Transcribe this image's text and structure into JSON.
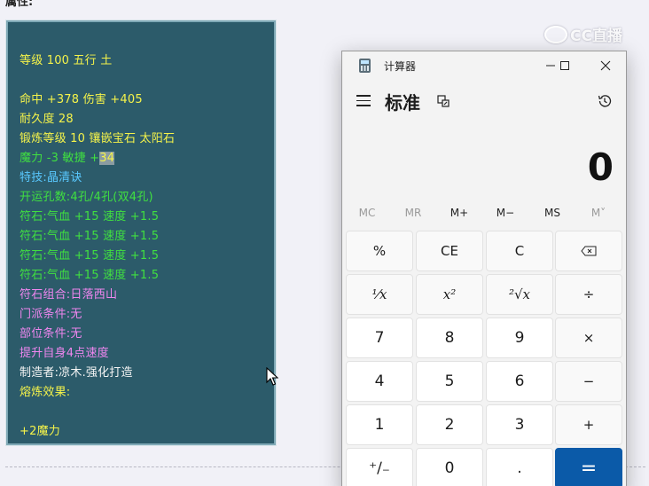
{
  "page": {
    "top_label": "属性:",
    "watermark": "CC直播"
  },
  "tooltip": {
    "lines": [
      {
        "text": "等级 100 五行 土",
        "color": "yellow"
      },
      {
        "text": "命中 +378 伤害 +405",
        "color": "yellow"
      },
      {
        "text": "耐久度 28",
        "color": "yellow"
      },
      {
        "text": "锻炼等级 10 镶嵌宝石 太阳石",
        "color": "yellow"
      },
      {
        "text": "魔力 -3 敏捷 +",
        "highlight": "34",
        "color": "green"
      },
      {
        "text": "特技:晶清诀",
        "color": "cyan"
      },
      {
        "text": "开运孔数:4孔/4孔(双4孔)",
        "color": "green"
      },
      {
        "text": "符石:气血 +15 速度 +1.5",
        "color": "green"
      },
      {
        "text": "符石:气血 +15 速度 +1.5",
        "color": "green"
      },
      {
        "text": "符石:气血 +15 速度 +1.5",
        "color": "green"
      },
      {
        "text": "符石:气血 +15 速度 +1.5",
        "color": "green"
      },
      {
        "text": "符石组合:日落西山",
        "color": "pink"
      },
      {
        "text": "门派条件:无",
        "color": "pink"
      },
      {
        "text": "部位条件:无",
        "color": "pink"
      },
      {
        "text": "提升自身4点速度",
        "color": "pink"
      },
      {
        "text": "制造者:凉木.强化打造",
        "color": "white"
      },
      {
        "text": "熔炼效果:",
        "color": "yellow"
      },
      {
        "text": "+2魔力",
        "color": "yellow"
      }
    ],
    "colors": {
      "yellow": "#f5f34a",
      "green": "#40e040",
      "cyan": "#59c8ff",
      "pink": "#ef86ef",
      "white": "#f4f4f4",
      "background": "#2c5b6a"
    }
  },
  "calculator": {
    "window_title": "计算器",
    "mode_title": "标准",
    "display_value": "0",
    "memory": [
      "MC",
      "MR",
      "M+",
      "M−",
      "MS",
      "M˅"
    ],
    "memory_enabled": [
      false,
      false,
      true,
      true,
      true,
      false
    ],
    "keys": [
      [
        "%",
        "CE",
        "C",
        "⌫"
      ],
      [
        "¹⁄x",
        "x²",
        "²√x",
        "÷"
      ],
      [
        "7",
        "8",
        "9",
        "×"
      ],
      [
        "4",
        "5",
        "6",
        "−"
      ],
      [
        "1",
        "2",
        "3",
        "+"
      ],
      [
        "⁺∕₋",
        "0",
        ".",
        "="
      ]
    ],
    "accent": "#0b5aa8",
    "icons": [
      "calculator-app-icon",
      "minimize-icon",
      "maximize-icon",
      "close-icon",
      "menu-icon",
      "keep-on-top-icon",
      "history-icon",
      "backspace-icon"
    ]
  }
}
